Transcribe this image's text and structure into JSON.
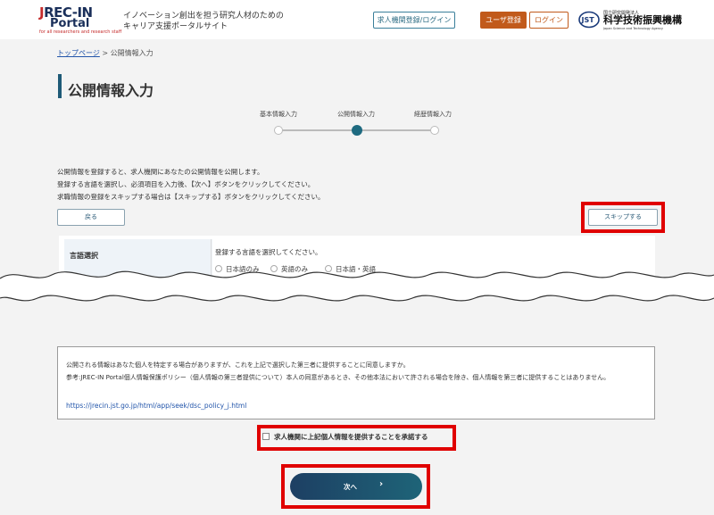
{
  "header": {
    "logo_main": "REC-IN",
    "logo_main_j": "J",
    "logo_sub": "Portal",
    "logo_tag": "for all researchers and research staff",
    "tagline_line1": "イノベーション創出を担う研究人材のための",
    "tagline_line2": "キャリア支援ポータルサイト",
    "org_login": "求人機関登録/ログイン",
    "user_register": "ユーザ登録",
    "login": "ログイン",
    "jst_small": "国立研究開発法人",
    "jst_name": "科学技術振興機構",
    "jst_en": "Japan Science and Technology Agency",
    "jst_mark": "JST",
    "colors": {
      "brand_navy": "#1a2f5a",
      "brand_red": "#c52b2b",
      "register_orange": "#c15a1b",
      "accent_teal": "#1e6a80"
    }
  },
  "breadcrumb": {
    "home": "トップページ",
    "separator": ">",
    "current": "公開情報入力"
  },
  "page_title": "公開情報入力",
  "steps": {
    "items": [
      "基本情報入力",
      "公開情報入力",
      "経歴情報入力"
    ],
    "current_index": 1
  },
  "intro": {
    "line1": "公開情報を登録すると、求人機関にあなたの公開情報を公開します。",
    "line2": "登録する言語を選択し、必須項目を入力後、【次へ】ボタンをクリックしてください。",
    "line3": "求職情報の登録をスキップする場合は【スキップする】ボタンをクリックしてください。"
  },
  "buttons": {
    "back": "戻る",
    "skip": "スキップする",
    "next": "次へ",
    "next_chevron": "›"
  },
  "language": {
    "label": "言語選択",
    "prompt": "登録する言語を選択してください。",
    "options": [
      "日本語のみ",
      "英語のみ",
      "日本語・英語"
    ]
  },
  "consent": {
    "line1": "公開される情報はあなた個人を特定する場合がありますが、これを上記で選択した第三者に提供することに同意しますか。",
    "line2": "参考:JREC-IN Portal個人情報保護ポリシー（個人情報の第三者提供について）本人の同意があるとき、その他本法において許される場合を除き、個人情報を第三者に提供することはありません。",
    "link": "https://jrecin.jst.go.jp/html/app/seek/dsc_policy_j.html"
  },
  "agree_checkbox": {
    "label": "求人機関に上記個人情報を提供することを承諾する",
    "checked": false
  }
}
